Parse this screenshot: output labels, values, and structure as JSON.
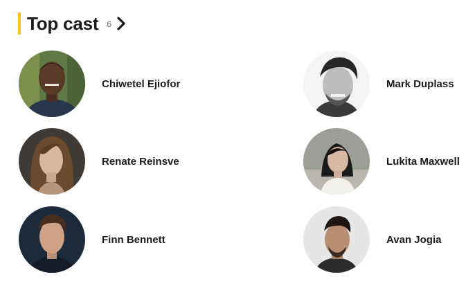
{
  "section": {
    "title": "Top cast",
    "count": "6",
    "accent_color": "#f5c518",
    "more_icon": "chevron-right-icon"
  },
  "cast": [
    {
      "name": "Chiwetel Ejiofor"
    },
    {
      "name": "Mark Duplass"
    },
    {
      "name": "Renate Reinsve"
    },
    {
      "name": "Lukita Maxwell"
    },
    {
      "name": "Finn Bennett"
    },
    {
      "name": "Avan Jogia"
    }
  ]
}
